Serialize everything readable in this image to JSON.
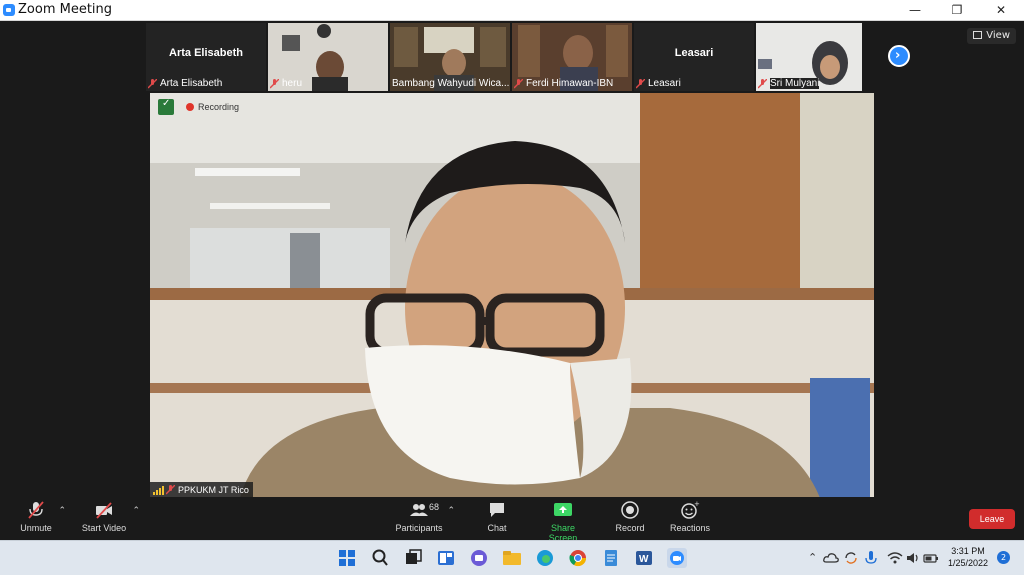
{
  "window": {
    "title": "Zoom Meeting",
    "minimize": "—",
    "restore": "❐",
    "close": "✕"
  },
  "view_button": "View",
  "participants_strip": [
    {
      "name": "Arta Elisabeth",
      "label": "Arta Elisabeth",
      "video": false
    },
    {
      "name": "heru",
      "label": "heru",
      "video": true
    },
    {
      "name": "Bambang Wahyudi Wica...",
      "label": "Bambang Wahyudi Wica...",
      "video": true
    },
    {
      "name": "Ferdi Himawan-IBN",
      "label": "Ferdi Himawan-IBN",
      "video": true
    },
    {
      "name": "Leasari",
      "label": "Leasari",
      "video": false
    },
    {
      "name": "Sri Mulyani",
      "label": "Sri Mulyani",
      "video": true
    }
  ],
  "speaker": {
    "recording_text": "Recording",
    "name_label": "PPKUKM JT Rico"
  },
  "toolbar": {
    "unmute": "Unmute",
    "start_video": "Start Video",
    "participants": "Participants",
    "participants_count": "68",
    "chat": "Chat",
    "share_screen": "Share Screen",
    "record": "Record",
    "reactions": "Reactions",
    "leave": "Leave"
  },
  "taskbar": {
    "time": "3:31 PM",
    "date": "1/25/2022",
    "notifications": "2"
  },
  "colors": {
    "accent": "#2d8cff",
    "share_green": "#3dd665",
    "leave_red": "#d12c2c",
    "toolbar_bg": "#1a1a1a"
  }
}
